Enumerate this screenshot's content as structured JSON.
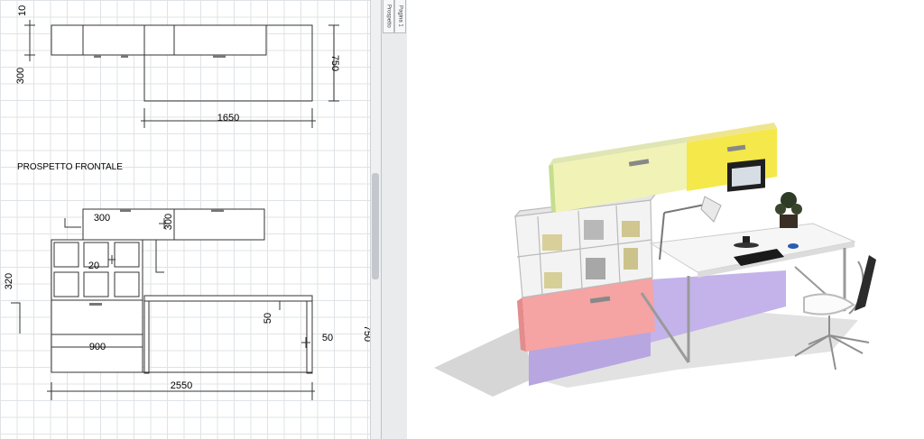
{
  "tabs": {
    "tab1": "Prospetto",
    "tab2": "Pagina 1"
  },
  "drawing": {
    "top_view": {
      "dim_depth_top": "10",
      "dim_left": "300",
      "dim_height": "750",
      "dim_width": "1650"
    },
    "section_label": "PROSPETTO FRONTALE",
    "front_view": {
      "dim_shelf_depth": "300",
      "dim_shelf_height": "300",
      "dim_gap": "20",
      "dim_side": "320",
      "dim_desk_thickness": "50",
      "dim_leg_offset": "50",
      "dim_total_height": "750",
      "dim_drawer_width": "900",
      "dim_total_width": "2550"
    }
  },
  "colors": {
    "cabinet_green": "#c5de8e",
    "cabinet_lightyellow": "#f1f3b6",
    "cabinet_yellow": "#f5e84a",
    "cabinet_pink": "#f5a3a3",
    "panel_lavender": "#b8a6e0",
    "desk_white": "#f6f6f6"
  }
}
